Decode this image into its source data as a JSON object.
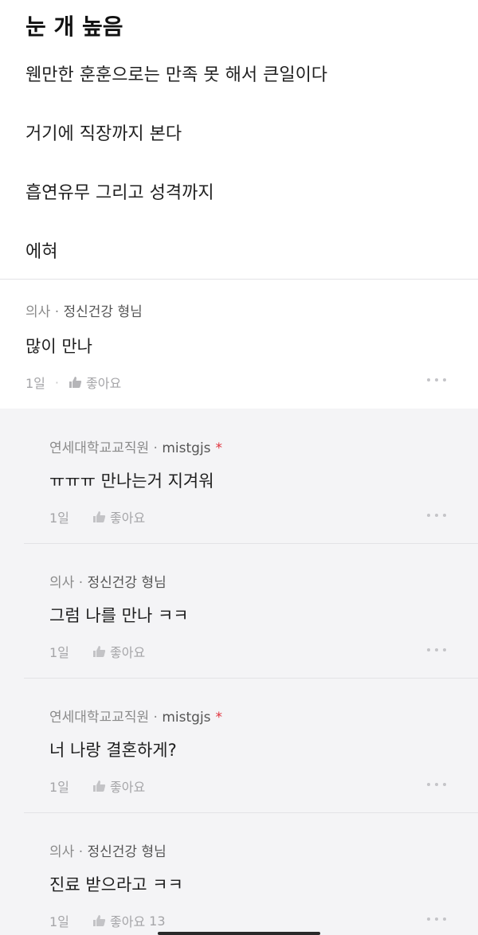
{
  "post": {
    "title": "눈 개 높음",
    "lines": [
      "웬만한 훈훈으로는 만족 못 해서 큰일이다",
      "거기에 직장까지 본다",
      "흡연유무 그리고 성격까지",
      "에혀"
    ]
  },
  "comments": [
    {
      "job": "의사",
      "sep": "·",
      "nick": "정신건강 형님",
      "op": false,
      "text": "많이 만나",
      "time": "1일",
      "like_label": "좋아요",
      "likes": ""
    },
    {
      "job": "연세대학교교직원",
      "sep": "·",
      "nick": "mistgjs",
      "op": true,
      "star": "*",
      "text": "ㅠㅠㅠ 만나는거 지겨워",
      "time": "1일",
      "like_label": "좋아요",
      "likes": ""
    },
    {
      "job": "의사",
      "sep": "·",
      "nick": "정신건강 형님",
      "op": false,
      "text": "그럼 나를 만나 ㅋㅋ",
      "time": "1일",
      "like_label": "좋아요",
      "likes": ""
    },
    {
      "job": "연세대학교교직원",
      "sep": "·",
      "nick": "mistgjs",
      "op": true,
      "star": "*",
      "text": "너 나랑 결혼하게?",
      "time": "1일",
      "like_label": "좋아요",
      "likes": ""
    },
    {
      "job": "의사",
      "sep": "·",
      "nick": "정신건강 형님",
      "op": false,
      "text": "진료 받으라고 ㅋㅋ",
      "time": "1일",
      "like_label": "좋아요",
      "likes": "13"
    }
  ],
  "icons": {
    "like": "thumbs-up-icon",
    "more": "more-dots-icon"
  },
  "colors": {
    "background": "#ffffff",
    "reply_background": "#f4f4f6",
    "op_star": "#e0323c",
    "meta": "#a5a5a8"
  }
}
